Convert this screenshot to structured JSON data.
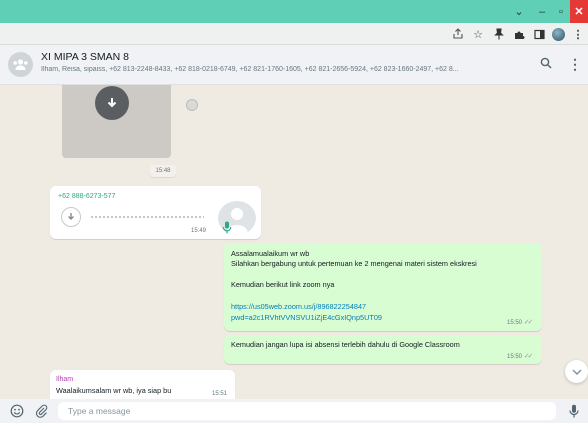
{
  "browser": {
    "window_controls": {
      "chevron": "⌄",
      "minimize": "–",
      "maximize": "▫",
      "close": "✕"
    },
    "toolbar_icons": [
      "share-icon",
      "star-icon",
      "pin-icon",
      "extensions-icon",
      "sidebar-icon",
      "profile-icon",
      "more-icon"
    ]
  },
  "chat_header": {
    "title": "XI MIPA 3 SMAN 8",
    "participants": "Ilham, Reisa, sipaiss, +62 813-2248-8433, +62 818-0218-6749, +62 821-1760-1605, +62 821-2656-5924, +62 823-1660-2497, +62 8..."
  },
  "messages": {
    "image_time": "15:48",
    "audio": {
      "sender": "+62 888-6273-577",
      "time": "15:49"
    },
    "outgoing1": {
      "lines": [
        "Assalamualaikum wr wb",
        "Silahkan bergabung untuk pertemuan ke 2 mengenai materi sistem ekskresi",
        "",
        "Kemudian berikut link zoom nya"
      ],
      "link_lines": [
        "https://us05web.zoom.us/j/896822254847",
        "pwd=a2c1RVhtVVNSVU1iZjE4cGxIQnp5UT09"
      ],
      "time": "15:50"
    },
    "outgoing2": {
      "text": "Kemudian jangan lupa isi absensi terlebih dahulu di Google Classroom",
      "time": "15:50"
    },
    "incoming": {
      "sender": "Ilham",
      "text": "Waalaikumsalam wr wb, iya siap bu",
      "time": "15:51"
    }
  },
  "composer": {
    "placeholder": "Type a message"
  },
  "colors": {
    "browser_bar": "#5fcfb6",
    "outgoing_bubble": "#d9fdd3",
    "incoming_bubble": "#ffffff",
    "chat_background": "#efeae2",
    "link": "#027eb5",
    "sender_audio": "#2aa786",
    "sender_ilham": "#b43bb4"
  }
}
